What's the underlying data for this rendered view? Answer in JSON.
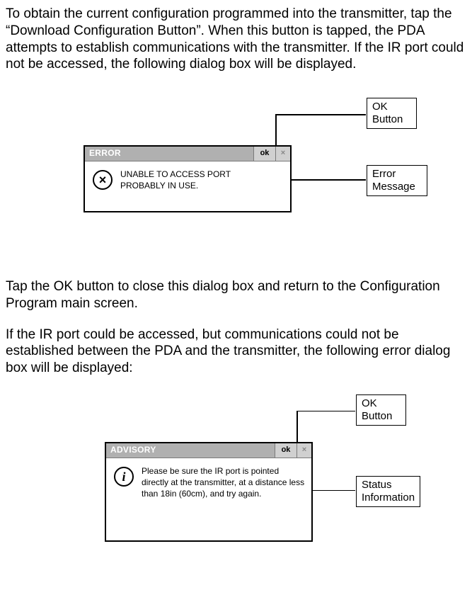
{
  "para1": "To obtain the current configuration programmed into the transmitter, tap the “Download Configuration Button”.  When this button is tapped, the PDA attempts to establish communications with the transmitter.  If the IR port could not be accessed, the following dialog box will be displayed.",
  "para2": "Tap the OK button to close this dialog box and return to the Configuration Program main screen.",
  "para3": "If the IR port could be accessed, but communications could not be established between the PDA and the transmitter, the following error dialog box will be displayed:",
  "dialog1": {
    "title": "ERROR",
    "ok": "ok",
    "aux": "×",
    "icon_glyph": "×",
    "msg": "UNABLE TO ACCESS PORT\nPROBABLY IN USE."
  },
  "dialog2": {
    "title": "ADVISORY",
    "ok": "ok",
    "aux": "×",
    "icon_glyph": "i",
    "msg": "Please be sure the IR port is pointed directly at the transmitter, at a distance less than 18in (60cm), and try again."
  },
  "callouts": {
    "ok_button": "OK\nButton",
    "error_message": "Error\nMessage",
    "status_info": "Status\nInformation"
  }
}
